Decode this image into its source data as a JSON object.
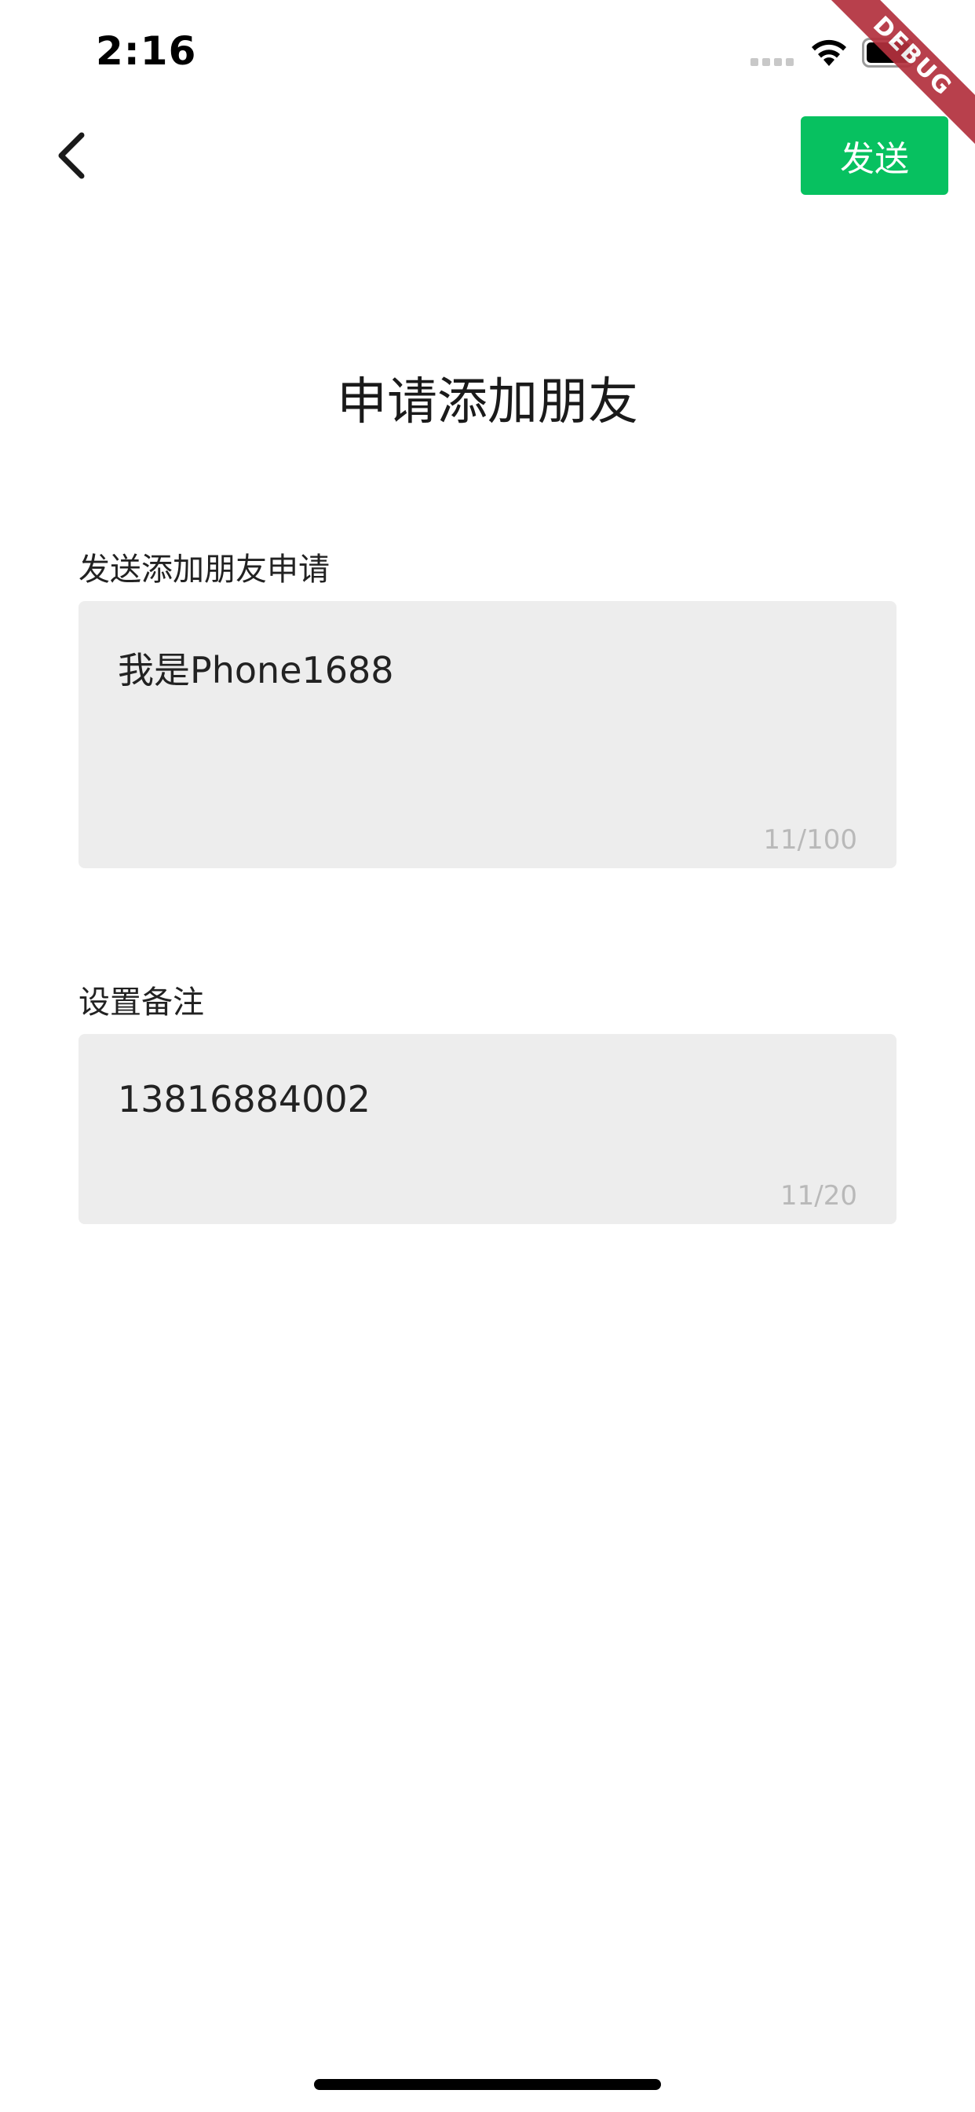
{
  "status_bar": {
    "time": "2:16"
  },
  "debug_ribbon": {
    "label": "DEBUG"
  },
  "nav": {
    "send_label": "发送"
  },
  "page": {
    "title": "申请添加朋友"
  },
  "request_field": {
    "label": "发送添加朋友申请",
    "value": "我是Phone1688",
    "counter": "11/100"
  },
  "remark_field": {
    "label": "设置备注",
    "value": "13816884002",
    "counter": "11/20"
  },
  "colors": {
    "accent": "#07c160",
    "field_background": "#ededed",
    "counter_text": "#b9b9b9",
    "ribbon": "#b3303d"
  },
  "icons": {
    "back": "chevron-left-icon",
    "signal": "signal-icon",
    "wifi": "wifi-icon",
    "battery": "battery-icon"
  }
}
